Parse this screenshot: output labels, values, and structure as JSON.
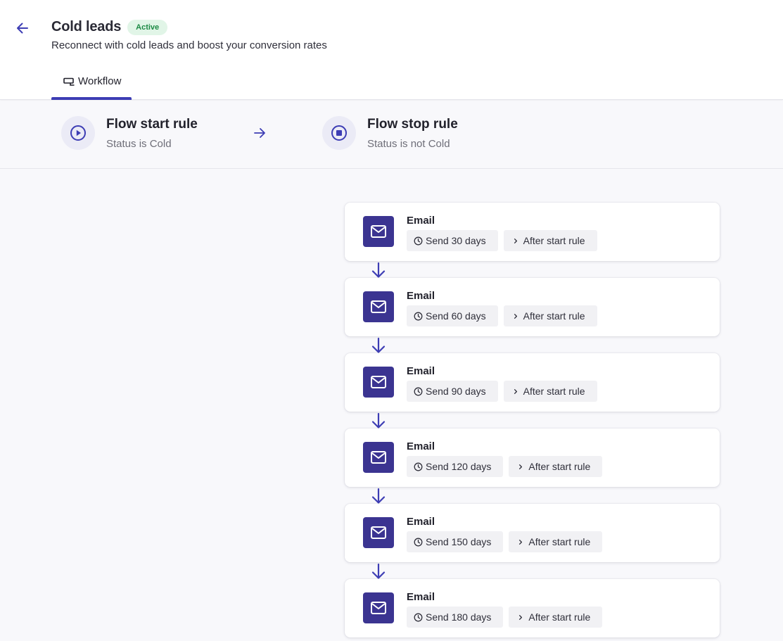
{
  "header": {
    "title": "Cold leads",
    "status_badge": "Active",
    "subtitle": "Reconnect with cold leads and boost your conversion rates",
    "back_icon": "arrow-left-icon"
  },
  "tabs": [
    {
      "label": "Workflow",
      "icon": "workflow-icon",
      "active": true
    }
  ],
  "rules": {
    "start": {
      "title": "Flow start rule",
      "condition": "Status is Cold",
      "icon": "play-circle-icon"
    },
    "stop": {
      "title": "Flow stop rule",
      "condition": "Status is not Cold",
      "icon": "stop-circle-icon"
    }
  },
  "steps": [
    {
      "type": "Email",
      "delay": "Send 30 days",
      "trigger": "After start rule"
    },
    {
      "type": "Email",
      "delay": "Send 60 days",
      "trigger": "After start rule"
    },
    {
      "type": "Email",
      "delay": "Send 90 days",
      "trigger": "After start rule"
    },
    {
      "type": "Email",
      "delay": "Send 120 days",
      "trigger": "After start rule"
    },
    {
      "type": "Email",
      "delay": "Send 150 days",
      "trigger": "After start rule"
    },
    {
      "type": "Email",
      "delay": "Send 180 days",
      "trigger": "After start rule"
    }
  ],
  "colors": {
    "accent": "#3d3db4",
    "email_icon_bg": "#3b3491",
    "badge_bg": "#e1f5e7",
    "badge_text": "#1d8a45"
  }
}
